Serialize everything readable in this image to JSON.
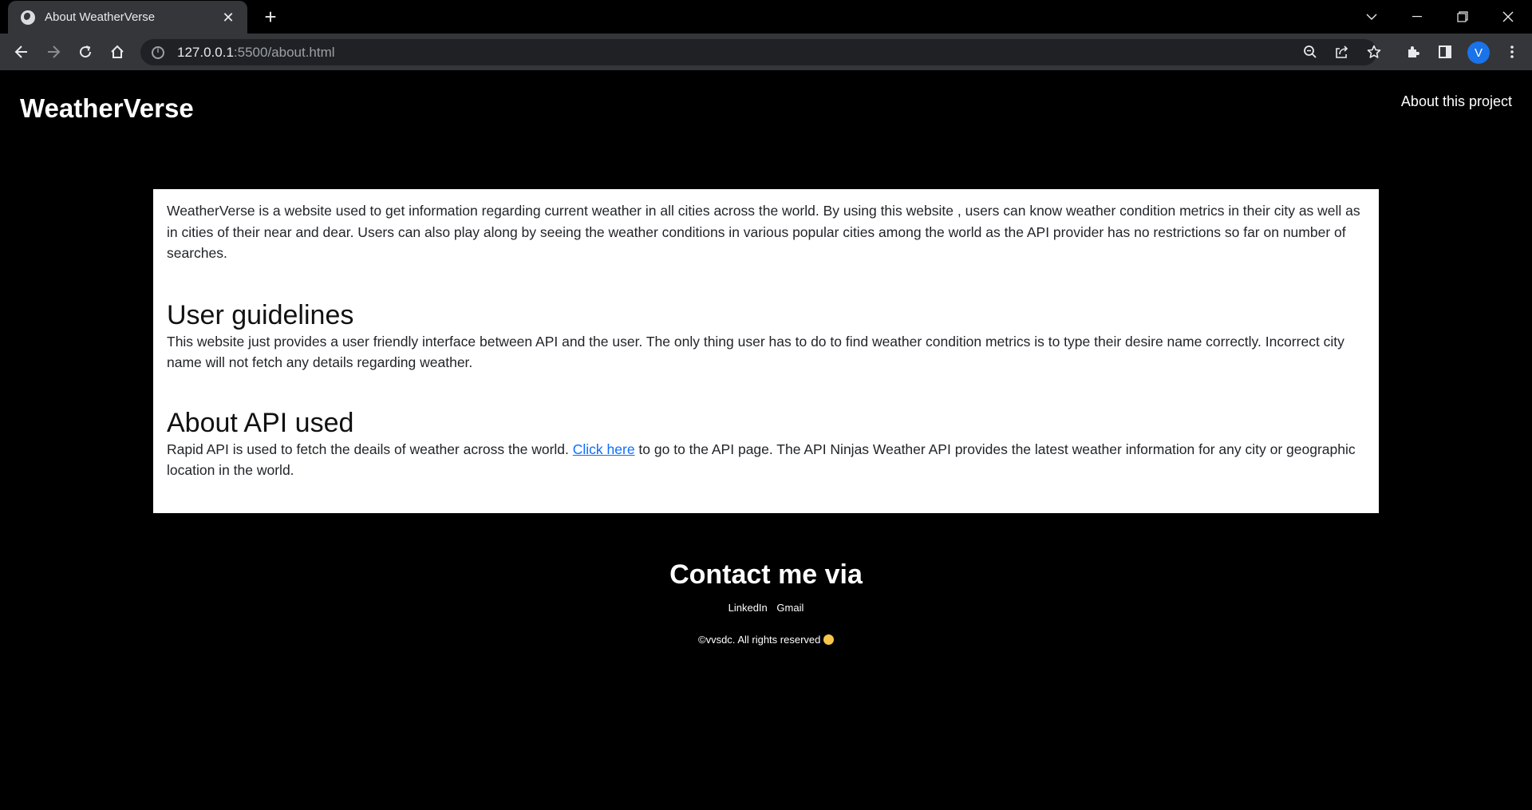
{
  "browser": {
    "tab_title": "About WeatherVerse",
    "url_host": "127.0.0.1",
    "url_path": ":5500/about.html",
    "profile_initial": "V",
    "icons": [
      "globe-icon",
      "close-icon",
      "plus-icon",
      "chevron-down-icon",
      "minimize-icon",
      "restore-icon",
      "close-window-icon",
      "back-icon",
      "forward-icon",
      "reload-icon",
      "home-icon",
      "info-icon",
      "zoom-icon",
      "share-icon",
      "star-icon",
      "extensions-icon",
      "side-panel-icon",
      "kebab-menu-icon"
    ]
  },
  "header": {
    "brand": "WeatherVerse",
    "nav_about": "About this project"
  },
  "content": {
    "intro": "WeatherVerse is a website used to get information regarding current weather in all cities across the world. By using this website , users can know weather condition metrics in their city as well as in cities of their near and dear. Users can also play along by seeing the weather conditions in various popular cities among the world as the API provider has no restrictions so far on number of searches.",
    "guidelines_heading": "User guidelines",
    "guidelines_text": "This website just provides a user friendly interface between API and the user. The only thing user has to do to find weather condition metrics is to type their desire name correctly. Incorrect city name will not fetch any details regarding weather.",
    "api_heading": "About API used",
    "api_text_before": "Rapid API is used to fetch the deails of weather across the world. ",
    "api_link": "Click here",
    "api_text_after": " to go to the API page. The API Ninjas Weather API provides the latest weather information for any city or geographic location in the world."
  },
  "footer": {
    "contact_heading": "Contact me via",
    "linkedin": "LinkedIn",
    "gmail": "Gmail",
    "copyright": "©vvsdc. All rights reserved"
  },
  "colors": {
    "page_bg": "#000000",
    "card_bg": "#ffffff",
    "link": "#0d6efd",
    "toolbar": "#35363a"
  }
}
